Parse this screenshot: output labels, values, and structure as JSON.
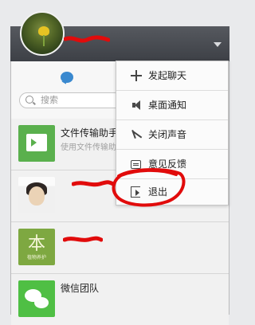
{
  "header": {
    "menu_label": "More options",
    "avatar_alt": "profile avatar"
  },
  "search": {
    "placeholder": "搜索"
  },
  "chats": [
    {
      "title": "文件传输助手",
      "subtitle": "使用文件传输助"
    },
    {
      "title": "",
      "subtitle": ""
    },
    {
      "title": "",
      "subtitle": ""
    },
    {
      "title": "微信团队",
      "subtitle": ""
    }
  ],
  "menu": {
    "items": [
      {
        "label": "发起聊天",
        "icon": "plus-icon"
      },
      {
        "label": "桌面通知",
        "icon": "speaker-icon"
      },
      {
        "label": "关闭声音",
        "icon": "mute-icon"
      },
      {
        "label": "意见反馈",
        "icon": "feedback-icon"
      },
      {
        "label": "退出",
        "icon": "logout-icon"
      }
    ]
  },
  "tree_avatar": {
    "char": "本",
    "text": "植物养护"
  },
  "colors": {
    "header": "#46494f",
    "accent_blue": "#3a89cf",
    "green": "#57b84f",
    "red_mark": "#e10b0b"
  }
}
